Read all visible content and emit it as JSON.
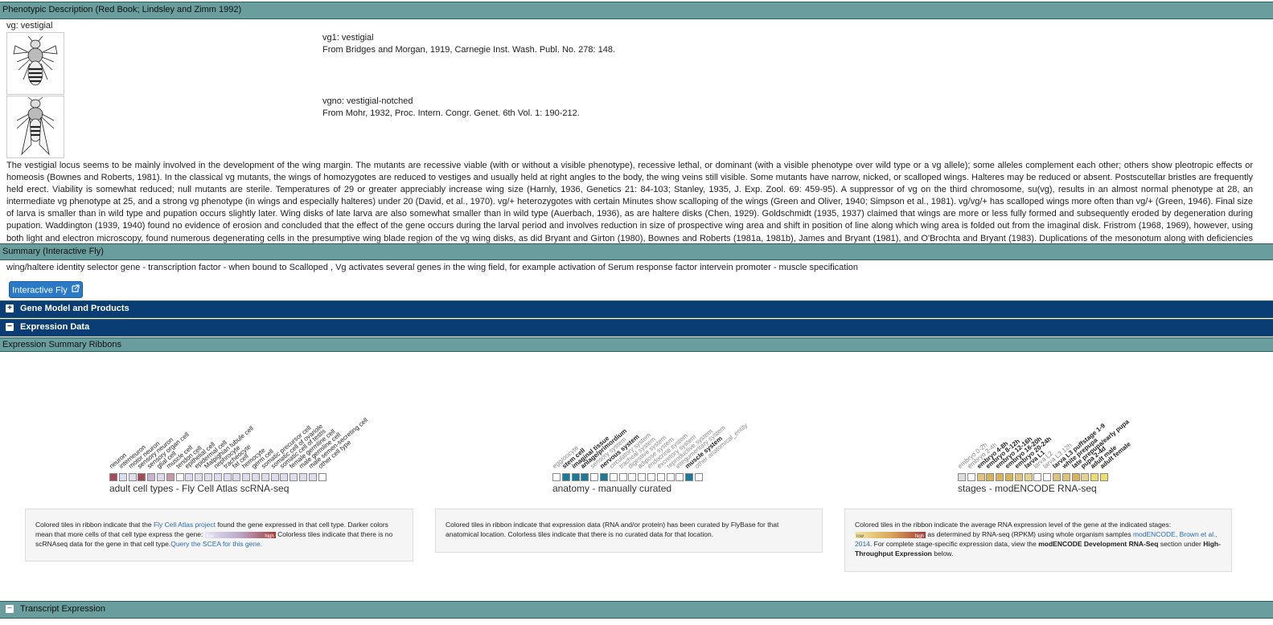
{
  "pheno": {
    "header": "Phenotypic Description (Red Book; Lindsley and Zimm 1992)",
    "gene_heading": "vg: vestigial",
    "alleles": [
      {
        "name": "vg1: vestigial",
        "ref": "From Bridges and Morgan, 1919, Carnegie Inst. Wash. Publ. No. 278: 148."
      },
      {
        "name": "vgno: vestigial-notched",
        "ref": "From Mohr, 1932, Proc. Intern. Congr. Genet. 6th Vol. 1: 190-212."
      }
    ],
    "description": "The vestigial locus seems to be mainly involved in the development of the wing margin. The mutants are recessive viable (with or without a visible phenotype), recessive lethal, or dominant (with a visible phenotype over wild type or a vg allele); some alleles complement each other; others show pleotropic effects or homeosis (Bownes and Roberts, 1981). In the classical vg mutants, the wings of homozygotes are reduced to vestiges and usually held at right angles to the body, the wing veins still visible. Some mutants have narrow, nicked, or scalloped wings. Halteres may be reduced or absent. Postscutellar bristles are frequently held erect. Viability is somewhat reduced; null mutants are sterile. Temperatures of 29 or greater appreciably increase wing size (Harnly, 1936, Genetics 21: 84-103; Stanley, 1935, J. Exp. Zool. 69: 459-95). A suppressor of vg on the third chromosome, su(vg), results in an almost normal phenotype at 28, an intermediate vg phenotype at 25, and a strong vg phenotype (in wings and especially halteres) under 20 (David, et al., 1970). vg/+ heterozygotes with certain Minutes show scalloping of the wings (Green and Oliver, 1940; Simpson et al., 1981). vg/vg/+ has scalloped wings more often than vg/+ (Green, 1946). Final size of larva is smaller than in wild type and pupation occurs slightly later. Wing disks of late larva are also somewhat smaller than in wild type (Auerbach, 1936), as are haltere disks (Chen, 1929). Goldschmidt (1935, 1937) claimed that wings are more or less fully formed and subsequently eroded by degeneration during pupation. Waddington (1939, 1940) found no evidence of erosion and concluded that the effect of the gene occurs during the larval period and involves reduction in size of prospective wing area and shift in position of line along which wing area is folded out from the imaginal disk. Fristrom (1968, 1969), however, using both light and electron microscopy, found numerous degenerating cells in the presumptive wing blade region of the vg wing disks, as did Bryant and Girton (1980), Bownes and Roberts (1981a, 1981b), James and Bryant (1981), and O'Brochta and Bryant (1983). Duplications of the mesonotum along with deficiencies of wing disk material occur in a small percentage of vg mutants (Girton and Bryant, 1980; James and Bryant, 1981)."
  },
  "summary": {
    "header": "Summary (Interactive Fly)",
    "text": "wing/haltere identity selector gene - transcription factor - when bound to Scalloped , Vg activates several genes in the wing field, for example activation of Serum response factor intervein promoter - muscle specification",
    "button": "Interactive Fly"
  },
  "sections": {
    "gene_model": "Gene Model and Products",
    "expression": "Expression Data",
    "ribbons_header": "Expression Summary Ribbons",
    "transcript": "Transcript Expression"
  },
  "ribbons": {
    "cell_types": {
      "title": "adult cell types - Fly Cell Atlas scRNA-seq",
      "labels": [
        "neuron",
        "interneuron",
        "motor neuron",
        "sensory neuron",
        "sensory organ cell",
        "glial cell",
        "muscle cell",
        "tendon cell",
        "epithelial cell",
        "epidermal cell",
        "Malpighian tubule cell",
        "nephrocyte",
        "tracheocyte",
        "fat cell",
        "hemocyte",
        "germ cell",
        "somatic precursor cell",
        "somatic cell of ovariole",
        "somatic cell of testis",
        "female germline cell",
        "male germline cell",
        "male semen-secreting cell",
        "other cell type"
      ],
      "colors": [
        "#a64a55",
        "#dcdcee",
        "#dcdcee",
        "#a64a55",
        "#c8b4cf",
        "#dcdcee",
        "#c49aaa",
        "#ffffff",
        "#dcdcee",
        "#dcdcee",
        "#dcdcee",
        "#dcdcee",
        "#dcdcee",
        "#dcdcee",
        "#dcdcee",
        "#dcdcee",
        "#dcdcee",
        "#dcdcee",
        "#dcdcee",
        "#dcdcee",
        "#dcdcee",
        "#dcdcee",
        "#ffffff"
      ]
    },
    "anatomy": {
      "title": "anatomy - manually curated",
      "labels": [
        "egg/oocyte",
        "stem cell",
        "imaginal tissue",
        "anlage/primordium",
        "sensory system",
        "nervous system",
        "circulatory system",
        "tracheal system",
        "digestive system",
        "adipose system",
        "endocrine system",
        "excretory system",
        "reproductive system",
        "integumentary system",
        "muscle system",
        "other anatomical_entity"
      ],
      "bold": [
        false,
        true,
        true,
        true,
        false,
        true,
        false,
        false,
        false,
        false,
        false,
        false,
        false,
        false,
        true,
        false
      ],
      "colors": [
        "#ffffff",
        "#1a7a99",
        "#1a7a99",
        "#1a7a99",
        "#ffffff",
        "#1a7a99",
        "#ffffff",
        "#ffffff",
        "#ffffff",
        "#ffffff",
        "#ffffff",
        "#ffffff",
        "#ffffff",
        "#ffffff",
        "#1a7a99",
        "#ffffff"
      ]
    },
    "stages": {
      "title": "stages - modENCODE RNA-seq",
      "labels": [
        "embryo 0-2h",
        "embryo 2-4h",
        "embryo 4-8h",
        "embryo 8-12h",
        "embryo 12-16h",
        "embryo 16-20h",
        "embryo 20-24h",
        "larva L1",
        "larva L2",
        "larva L3 12h",
        "larva L3 puffstage 1-9",
        "white prepupa",
        "late prepupa/early pupa",
        "pupa 2-4d",
        "adult male",
        "adult female"
      ],
      "bold": [
        false,
        false,
        true,
        true,
        true,
        true,
        true,
        true,
        false,
        false,
        true,
        true,
        true,
        true,
        true,
        true
      ],
      "colors": [
        "#dcdcdc",
        "#ffffff",
        "#e0c27a",
        "#d8b35a",
        "#d8b35a",
        "#d8b35a",
        "#e0c27a",
        "#e6d28e",
        "#ffffff",
        "#ffffff",
        "#e0c27a",
        "#e0c27a",
        "#d8b35a",
        "#e6d28e",
        "#f0dc6a",
        "#f0dc6a"
      ]
    }
  },
  "info": {
    "cell_types": {
      "p1": "Colored tiles in ribbon indicate that the ",
      "link1": "Fly Cell Atlas project",
      "p2": " found the gene expressed in that cell type. Darker colors mean that more cells of that cell type express the gene: ",
      "low": "low",
      "high": "high",
      "p3": " Colorless tiles indicate that there is no scRNAseq data for the gene in that cell type.",
      "link2": "Query the SCEA for this gene."
    },
    "anatomy": {
      "text": "Colored tiles in ribbon indicate that expression data (RNA and/or protein) has been curated by FlyBase for that anatomical location. Colorless tiles indicate that there is no curated data for that location."
    },
    "stages": {
      "p1": "Colored tiles in the ribbon indicate the average RNA expression level of the gene at the indicated stages:",
      "low": "low",
      "high": "high",
      "p2": " as determined by RNA-seq (RPKM) using whole organism samples ",
      "link1": "modENCODE, Brown et al., 2014",
      "p3": ". For complete stage-specific expression data, view the ",
      "bold1": "modENCODE Development RNA-Seq",
      "p4": " section under ",
      "bold2": "High-Throughput Expression",
      "p5": " below."
    }
  }
}
